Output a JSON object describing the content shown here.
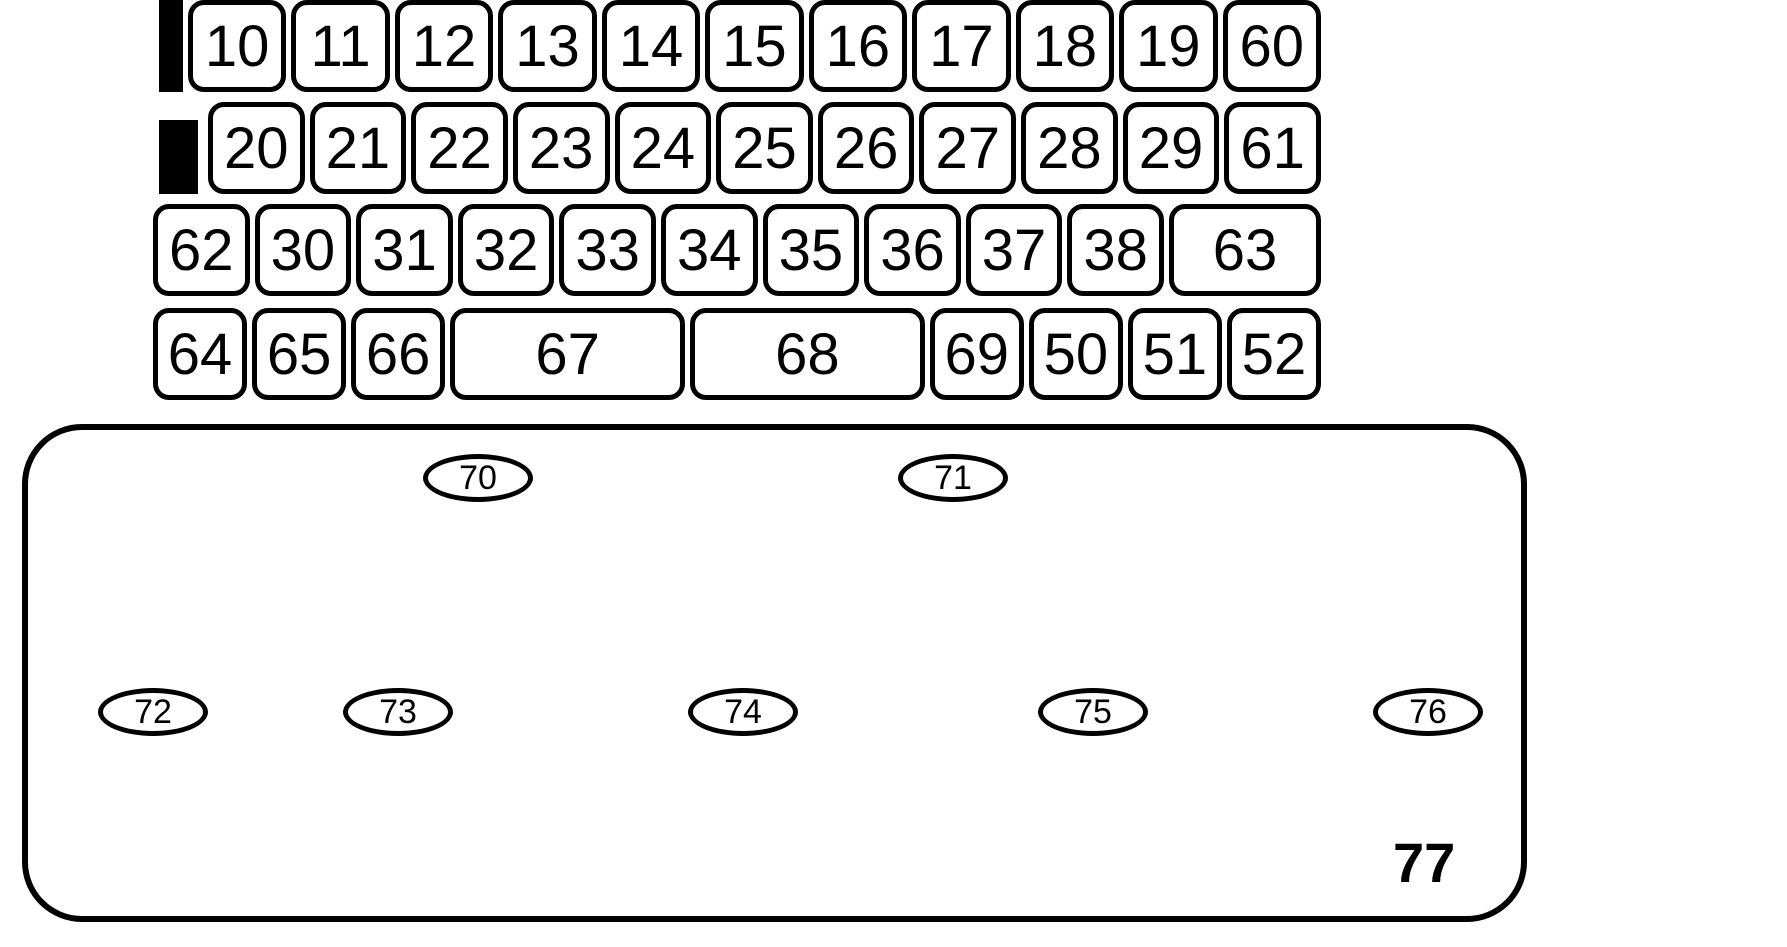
{
  "keys": {
    "row1": [
      "10",
      "11",
      "12",
      "13",
      "14",
      "15",
      "16",
      "17",
      "18",
      "19",
      "60"
    ],
    "row2": [
      "20",
      "21",
      "22",
      "23",
      "24",
      "25",
      "26",
      "27",
      "28",
      "29",
      "61"
    ],
    "row3": [
      "62",
      "30",
      "31",
      "32",
      "33",
      "34",
      "35",
      "36",
      "37",
      "38",
      "63"
    ],
    "row4": [
      "64",
      "65",
      "66",
      "67",
      "68",
      "69",
      "50",
      "51",
      "52"
    ]
  },
  "touchpad": {
    "ovals": {
      "o70": "70",
      "o71": "71",
      "o72": "72",
      "o73": "73",
      "o74": "74",
      "o75": "75",
      "o76": "76"
    },
    "label": "77"
  }
}
